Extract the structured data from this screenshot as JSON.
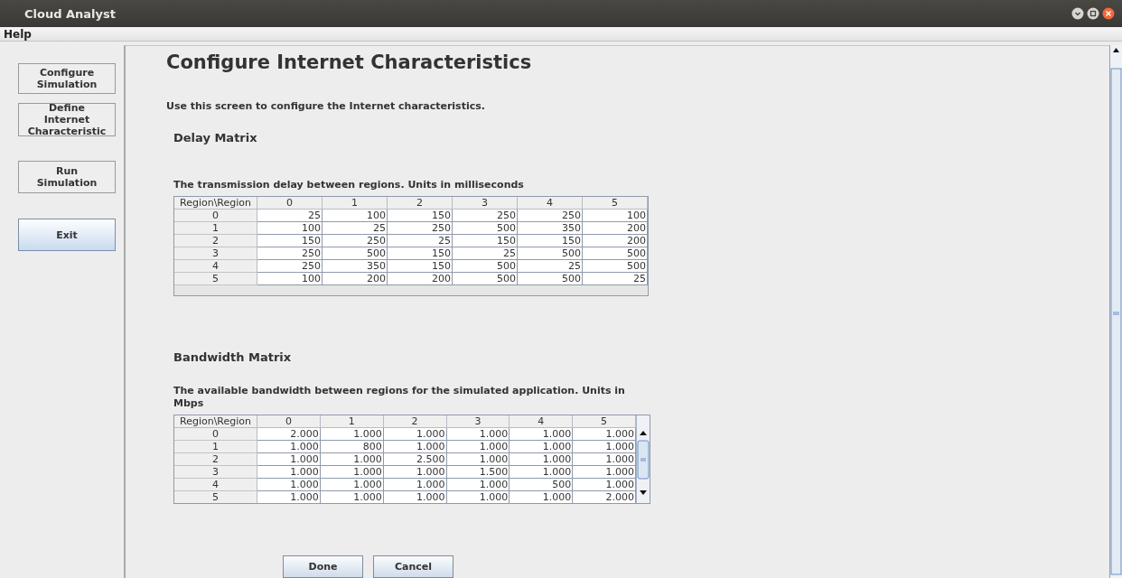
{
  "window": {
    "title": "Cloud Analyst"
  },
  "menu": [
    "Help"
  ],
  "sidebar": {
    "buttons": [
      {
        "lines": [
          "Configure",
          "Simulation"
        ],
        "selected": false
      },
      {
        "lines": [
          "Define",
          "Internet",
          "Characteristic"
        ],
        "selected": false
      },
      {
        "lines": [
          "Run",
          "Simulation"
        ],
        "selected": false
      },
      {
        "lines": [
          "Exit"
        ],
        "selected": true
      }
    ]
  },
  "page": {
    "title": "Configure Internet Characteristics",
    "description": "Use this screen to configure the Internet characteristics."
  },
  "matrices": [
    {
      "heading": "Delay Matrix",
      "caption": "The transmission delay between regions. Units in milliseconds",
      "scrollable": false,
      "columns": [
        "Region\\Region",
        "0",
        "1",
        "2",
        "3",
        "4",
        "5"
      ],
      "rows": [
        [
          "0",
          "25",
          "100",
          "150",
          "250",
          "250",
          "100"
        ],
        [
          "1",
          "100",
          "25",
          "250",
          "500",
          "350",
          "200"
        ],
        [
          "2",
          "150",
          "250",
          "25",
          "150",
          "150",
          "200"
        ],
        [
          "3",
          "250",
          "500",
          "150",
          "25",
          "500",
          "500"
        ],
        [
          "4",
          "250",
          "350",
          "150",
          "500",
          "25",
          "500"
        ],
        [
          "5",
          "100",
          "200",
          "200",
          "500",
          "500",
          "25"
        ]
      ]
    },
    {
      "heading": "Bandwidth Matrix",
      "caption": "The available bandwidth between regions for the simulated application. Units in Mbps",
      "scrollable": true,
      "columns": [
        "Region\\Region",
        "0",
        "1",
        "2",
        "3",
        "4",
        "5"
      ],
      "rows": [
        [
          "0",
          "2.000",
          "1.000",
          "1.000",
          "1.000",
          "1.000",
          "1.000"
        ],
        [
          "1",
          "1.000",
          "800",
          "1.000",
          "1.000",
          "1.000",
          "1.000"
        ],
        [
          "2",
          "1.000",
          "1.000",
          "2.500",
          "1.000",
          "1.000",
          "1.000"
        ],
        [
          "3",
          "1.000",
          "1.000",
          "1.000",
          "1.500",
          "1.000",
          "1.000"
        ],
        [
          "4",
          "1.000",
          "1.000",
          "1.000",
          "1.000",
          "500",
          "1.000"
        ],
        [
          "5",
          "1.000",
          "1.000",
          "1.000",
          "1.000",
          "1.000",
          "2.000"
        ]
      ]
    }
  ],
  "actions": [
    "Done",
    "Cancel"
  ]
}
